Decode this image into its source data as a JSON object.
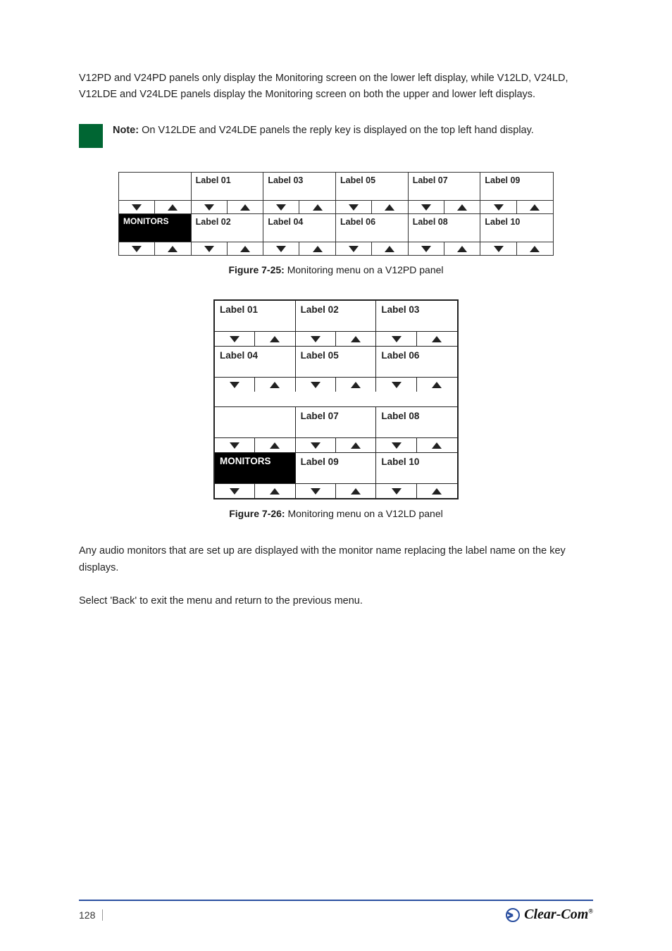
{
  "intro": "V12PD and V24PD panels only display the Monitoring screen on the lower left display, while V12LD, V24LD, V12LDE and V24LDE panels display the Monitoring screen on both the upper and lower left displays.",
  "note": {
    "bold": "Note:",
    "text": "On V12LDE and V24LDE panels the reply key is displayed on the top left hand display."
  },
  "fig25": {
    "top_row": [
      "",
      "Label 01",
      "Label 03",
      "Label 05",
      "Label 07",
      "Label 09"
    ],
    "bottom_row": [
      "MONITORS",
      "Label 02",
      "Label 04",
      "Label 06",
      "Label 08",
      "Label 10"
    ],
    "caption_bold": "Figure 7-25:",
    "caption": "Monitoring menu on a V12PD panel"
  },
  "fig26": {
    "rows": [
      [
        "Label 01",
        "Label 02",
        "Label 03"
      ],
      [
        "Label 04",
        "Label 05",
        "Label 06"
      ],
      [
        "",
        "Label 07",
        "Label 08"
      ],
      [
        "MONITORS",
        "Label 09",
        "Label 10"
      ]
    ],
    "caption_bold": "Figure 7-26:",
    "caption": "Monitoring menu on a V12LD panel"
  },
  "closing1": "Any audio monitors that are set up are displayed with the monitor name replacing the label name on the key displays.",
  "closing2": "Select 'Back' to exit the menu and return to the previous menu.",
  "page_number": "128",
  "brand": "Clear-Com"
}
